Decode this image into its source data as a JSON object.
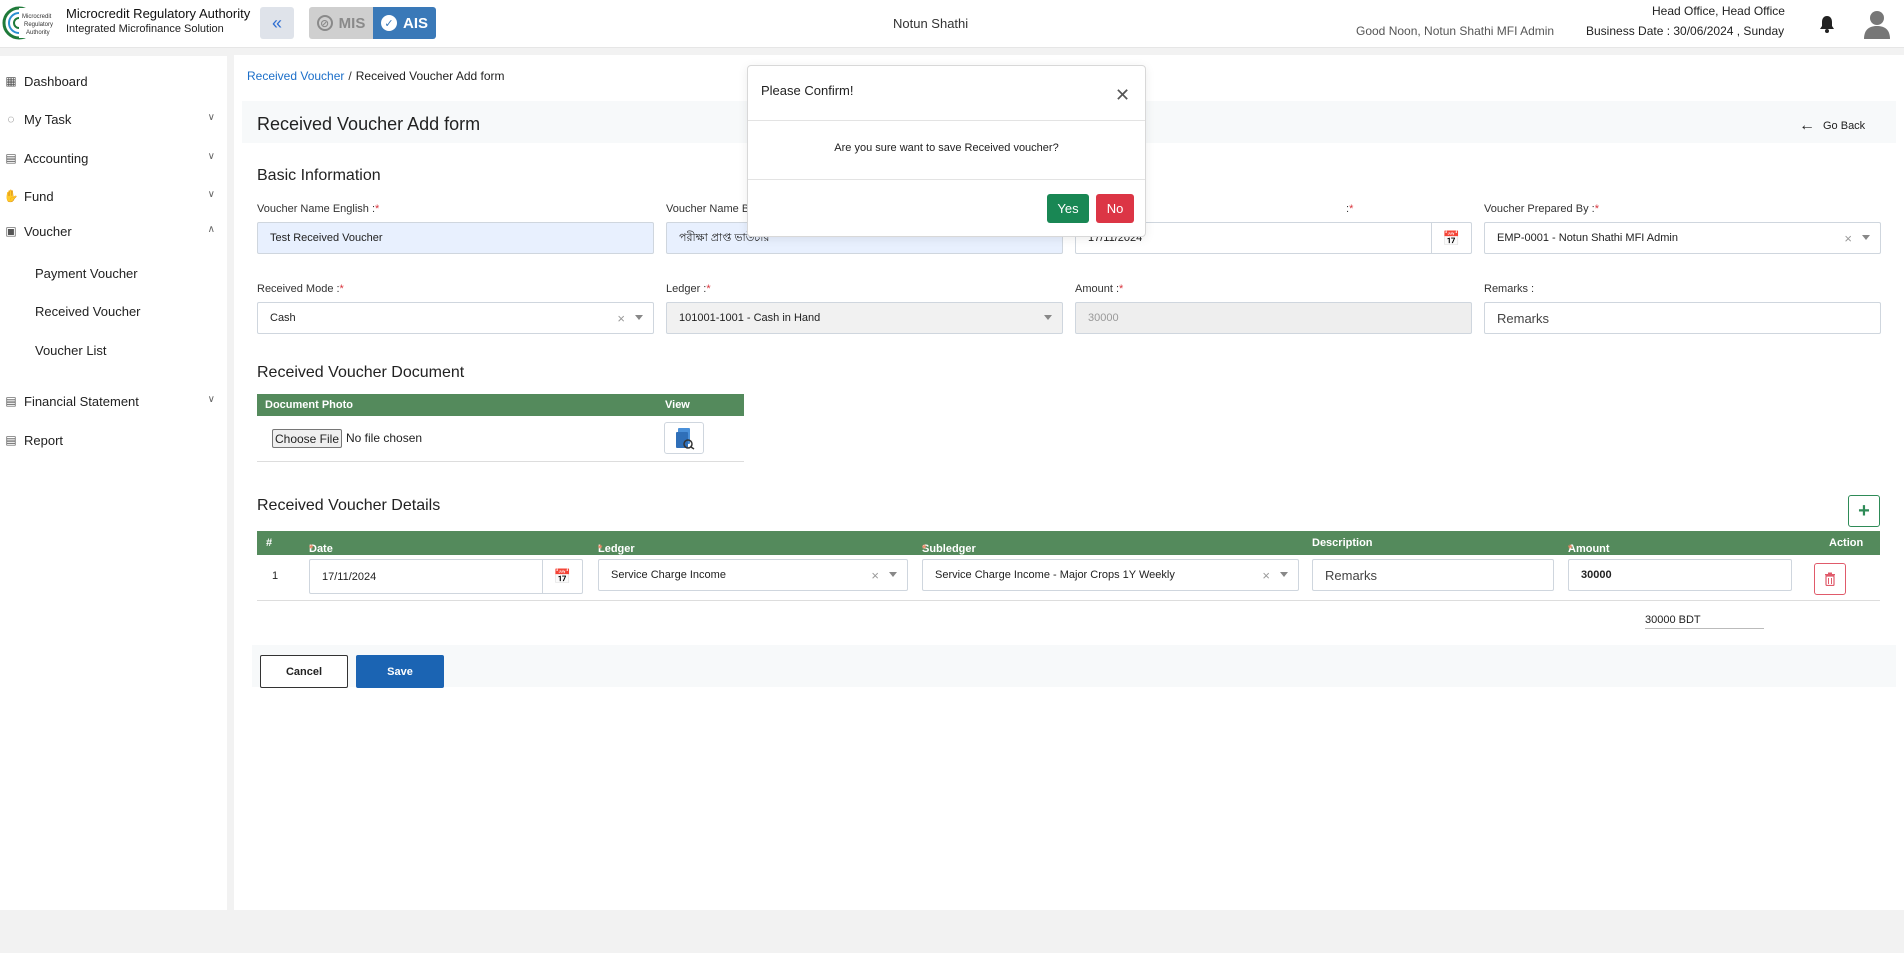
{
  "header": {
    "logo_text": "Microcredit Regulatory Authority",
    "brand_title": "Microcredit Regulatory Authority",
    "brand_subtitle": "Integrated Microfinance Solution",
    "mis_label": "MIS",
    "ais_label": "AIS",
    "org_name": "Notun Shathi",
    "greeting": "Good Noon, Notun Shathi MFI Admin",
    "office": "Head Office, Head Office",
    "business_date": "Business Date : 30/06/2024 , Sunday"
  },
  "sidebar": {
    "items": [
      {
        "label": "Dashboard"
      },
      {
        "label": "My Task"
      },
      {
        "label": "Accounting"
      },
      {
        "label": "Fund"
      },
      {
        "label": "Voucher"
      },
      {
        "label": "Financial Statement"
      },
      {
        "label": "Report"
      }
    ],
    "voucher_sub": [
      {
        "label": "Payment Voucher"
      },
      {
        "label": "Received Voucher"
      },
      {
        "label": "Voucher List"
      }
    ]
  },
  "breadcrumb": {
    "link": "Received Voucher",
    "sep": "/",
    "current": "Received Voucher Add form"
  },
  "page": {
    "title": "Received Voucher Add form",
    "go_back": "Go Back"
  },
  "basic": {
    "section_title": "Basic Information",
    "name_en_label": "Voucher Name English :",
    "name_en_value": "Test  Received Voucher",
    "name_bn_label": "Voucher Name B",
    "name_bn_value": "পরীক্ষা প্রাপ্ত ভাউচার",
    "date_label": ":",
    "date_value": "17/11/2024",
    "prepared_by_label": "Voucher Prepared By :",
    "prepared_by_value": "EMP-0001 - Notun Shathi MFI Admin",
    "mode_label": "Received Mode :",
    "mode_value": "Cash",
    "ledger_label": "Ledger :",
    "ledger_value": "101001-1001 - Cash in Hand",
    "amount_label": "Amount :",
    "amount_value": "30000",
    "remarks_label": "Remarks :",
    "remarks_placeholder": "Remarks",
    "required_mark": "*"
  },
  "document": {
    "section_title": "Received Voucher Document",
    "col_photo": "Document Photo",
    "col_view": "View",
    "choose_file": "Choose File",
    "no_file": "No file chosen"
  },
  "details": {
    "section_title": "Received Voucher Details",
    "columns": {
      "num": "#",
      "date": "Date",
      "ledger": "Ledger",
      "subledger": "Subledger",
      "description": "Description",
      "amount": "Amount",
      "action": "Action"
    },
    "rows": [
      {
        "num": "1",
        "date": "17/11/2024",
        "ledger": "Service Charge Income",
        "subledger": "Service Charge Income - Major Crops 1Y Weekly",
        "description_placeholder": "Remarks",
        "amount": "30000"
      }
    ],
    "total": "30000 BDT"
  },
  "actions": {
    "cancel": "Cancel",
    "save": "Save"
  },
  "modal": {
    "title": "Please Confirm!",
    "message": "Are you sure want to save Received voucher?",
    "yes": "Yes",
    "no": "No"
  },
  "colors": {
    "table_header": "#548a5c",
    "primary": "#1b64b3",
    "success": "#198754",
    "danger": "#dc3545"
  }
}
